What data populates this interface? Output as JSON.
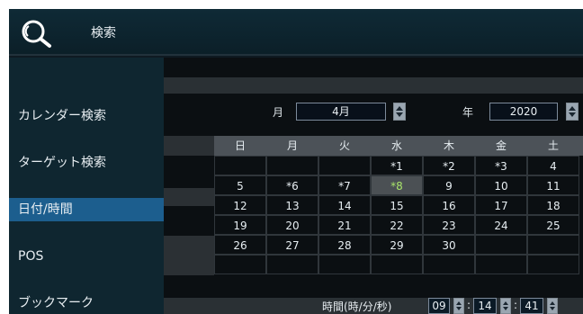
{
  "header": {
    "icon": "search-icon",
    "title": "検索"
  },
  "sidebar": {
    "items": [
      {
        "label": "カレンダー検索",
        "active": false
      },
      {
        "label": "ターゲット検索",
        "active": false
      },
      {
        "label": "日付/時間",
        "active": true
      },
      {
        "label": "POS",
        "active": false
      },
      {
        "label": "ブックマーク",
        "active": false
      }
    ]
  },
  "controls": {
    "month_label": "月",
    "month_value": "4月",
    "year_label": "年",
    "year_value": "2020"
  },
  "calendar": {
    "weekdays": [
      "日",
      "月",
      "火",
      "水",
      "木",
      "金",
      "土"
    ],
    "weeks": [
      [
        "",
        "",
        "",
        "*1",
        "*2",
        "*3",
        "4"
      ],
      [
        "5",
        "*6",
        "*7",
        "*8",
        "9",
        "10",
        "11"
      ],
      [
        "12",
        "13",
        "14",
        "15",
        "16",
        "17",
        "18"
      ],
      [
        "19",
        "20",
        "21",
        "22",
        "23",
        "24",
        "25"
      ],
      [
        "26",
        "27",
        "28",
        "29",
        "30",
        "",
        ""
      ],
      [
        "",
        "",
        "",
        "",
        "",
        "",
        ""
      ]
    ],
    "selected": "*8"
  },
  "time": {
    "label": "時間(時/分/秒)",
    "hour": "09",
    "minute": "14",
    "second": "41",
    "separator": ":"
  },
  "colors": {
    "accent": "#1c5e8e",
    "selected_text": "#a8e36a"
  }
}
